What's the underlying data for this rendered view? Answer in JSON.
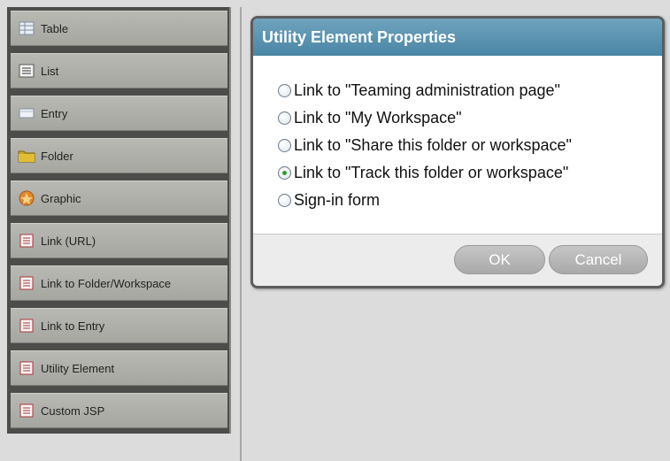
{
  "palette": {
    "items": [
      {
        "label": "Table",
        "icon": "table-icon"
      },
      {
        "label": "List",
        "icon": "list-icon"
      },
      {
        "label": "Entry",
        "icon": "entry-icon"
      },
      {
        "label": "Folder",
        "icon": "folder-icon"
      },
      {
        "label": "Graphic",
        "icon": "graphic-icon"
      },
      {
        "label": "Link (URL)",
        "icon": "link-url-icon"
      },
      {
        "label": "Link to Folder/Workspace",
        "icon": "link-folder-icon"
      },
      {
        "label": "Link to Entry",
        "icon": "link-entry-icon"
      },
      {
        "label": "Utility Element",
        "icon": "utility-element-icon"
      },
      {
        "label": "Custom JSP",
        "icon": "custom-jsp-icon"
      }
    ]
  },
  "dialog": {
    "title": "Utility Element Properties",
    "options": [
      {
        "label": "Link to \"Teaming administration page\"",
        "checked": false
      },
      {
        "label": "Link to \"My Workspace\"",
        "checked": false
      },
      {
        "label": "Link to \"Share this folder or workspace\"",
        "checked": false
      },
      {
        "label": "Link to \"Track this folder or workspace\"",
        "checked": true
      },
      {
        "label": "Sign-in form",
        "checked": false
      }
    ],
    "ok_label": "OK",
    "cancel_label": "Cancel"
  },
  "colors": {
    "title_bar": "#4a86a5",
    "selected_radio": "#2f9a2f"
  }
}
